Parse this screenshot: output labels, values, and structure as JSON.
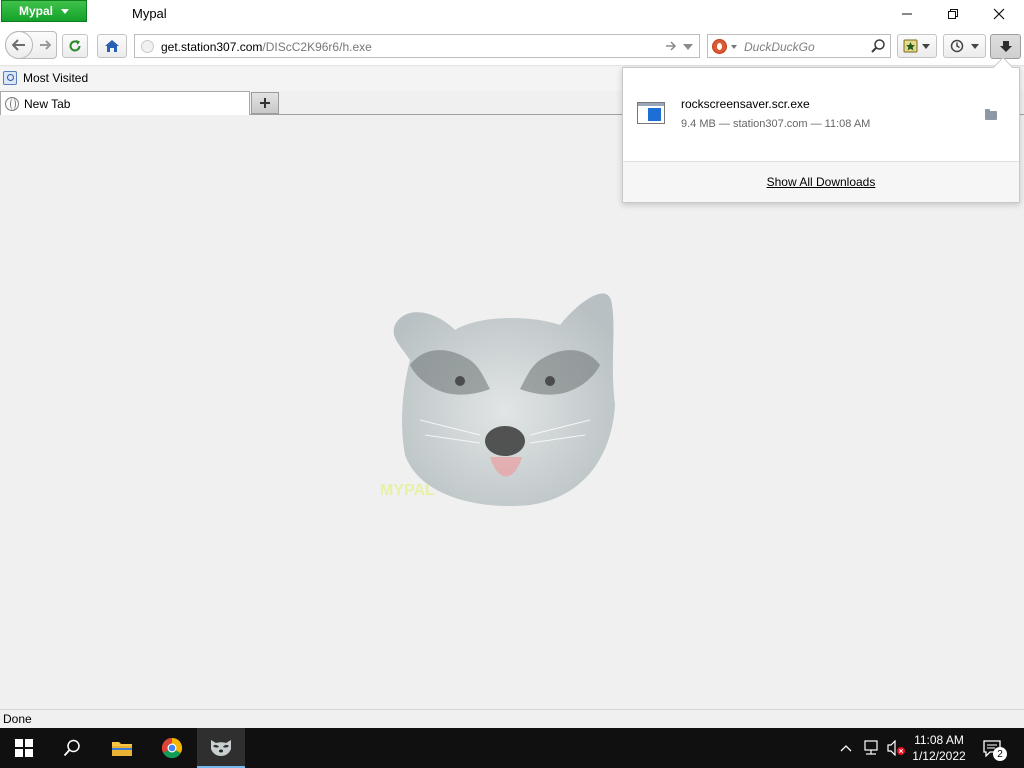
{
  "titlebar": {
    "app_menu_label": "Mypal",
    "window_title": "Mypal"
  },
  "navbar": {
    "url_domain": "get.station307.com",
    "url_path": "/DIScC2K96r6/h.exe",
    "search_placeholder": "DuckDuckGo"
  },
  "bookmarks": {
    "items": [
      {
        "label": "Most Visited"
      }
    ]
  },
  "tabs": [
    {
      "label": "New Tab",
      "active": true
    }
  ],
  "downloads_panel": {
    "items": [
      {
        "filename": "rockscreensaver.scr.exe",
        "meta": "9.4 MB — station307.com — 11:08 AM"
      }
    ],
    "show_all_label": "Show All Downloads"
  },
  "statusbar": {
    "text": "Done"
  },
  "taskbar": {
    "time": "11:08 AM",
    "date": "1/12/2022",
    "notification_count": "2"
  },
  "colors": {
    "app_menu_green": "#14a22a",
    "content_bg": "#f0f0f0",
    "taskbar_bg": "#101010",
    "taskbar_active_accent": "#76b9ed"
  }
}
